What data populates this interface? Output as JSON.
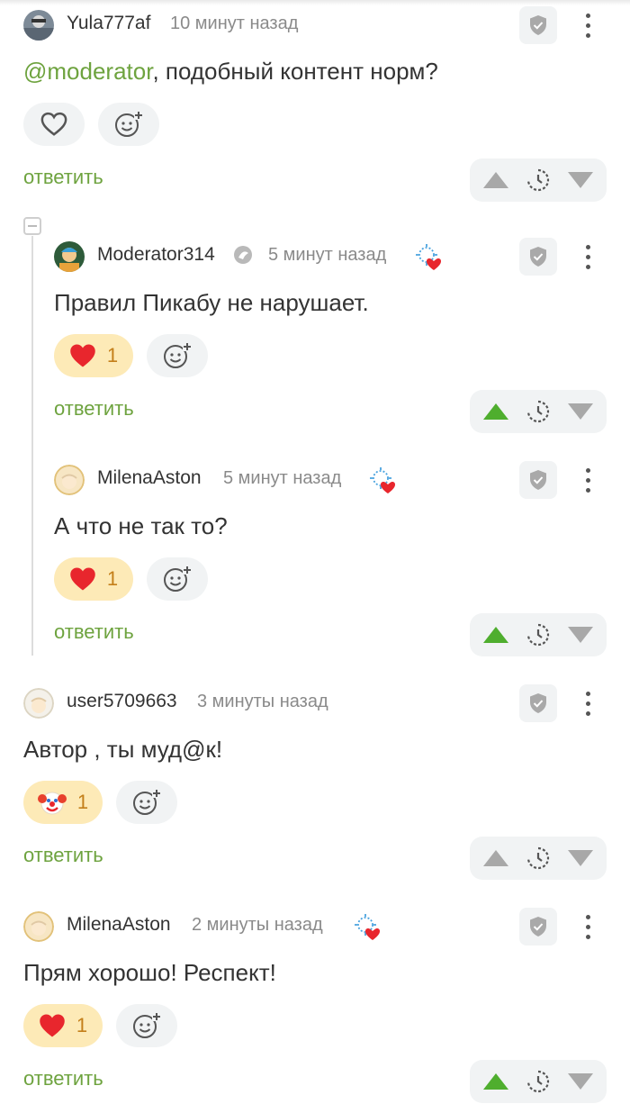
{
  "reply_label": "ответить",
  "colors": {
    "accent_green": "#6ea33f",
    "heart_red": "#e8262d",
    "active_pill": "#fdeab7",
    "pill_bg": "#f1f3f4",
    "vote_gray": "#a8a8a8"
  },
  "comments": [
    {
      "username": "Yula777af",
      "time": "10 минут назад",
      "mention": "@moderator",
      "text": ", подобный контент норм?",
      "reaction_icon": "heart-outline-icon",
      "reaction_count": "",
      "vote_state": "none"
    },
    {
      "username": "Moderator314",
      "time": "5 минут назад",
      "text": "Правил Пикабу не нарушает.",
      "reaction_icon": "heart-icon",
      "reaction_count": "1",
      "vote_state": "up"
    },
    {
      "username": "MilenaAston",
      "time": "5 минут назад",
      "text": "А что не так то?",
      "reaction_icon": "heart-icon",
      "reaction_count": "1",
      "vote_state": "up"
    },
    {
      "username": "user5709663",
      "time": "3 минуты назад",
      "text": "Автор , ты муд@к!",
      "reaction_icon": "clown-icon",
      "reaction_count": "1",
      "vote_state": "none"
    },
    {
      "username": "MilenaAston",
      "time": "2 минуты назад",
      "text": "Прям хорошо! Респект!",
      "reaction_icon": "heart-icon",
      "reaction_count": "1",
      "vote_state": "up"
    }
  ]
}
